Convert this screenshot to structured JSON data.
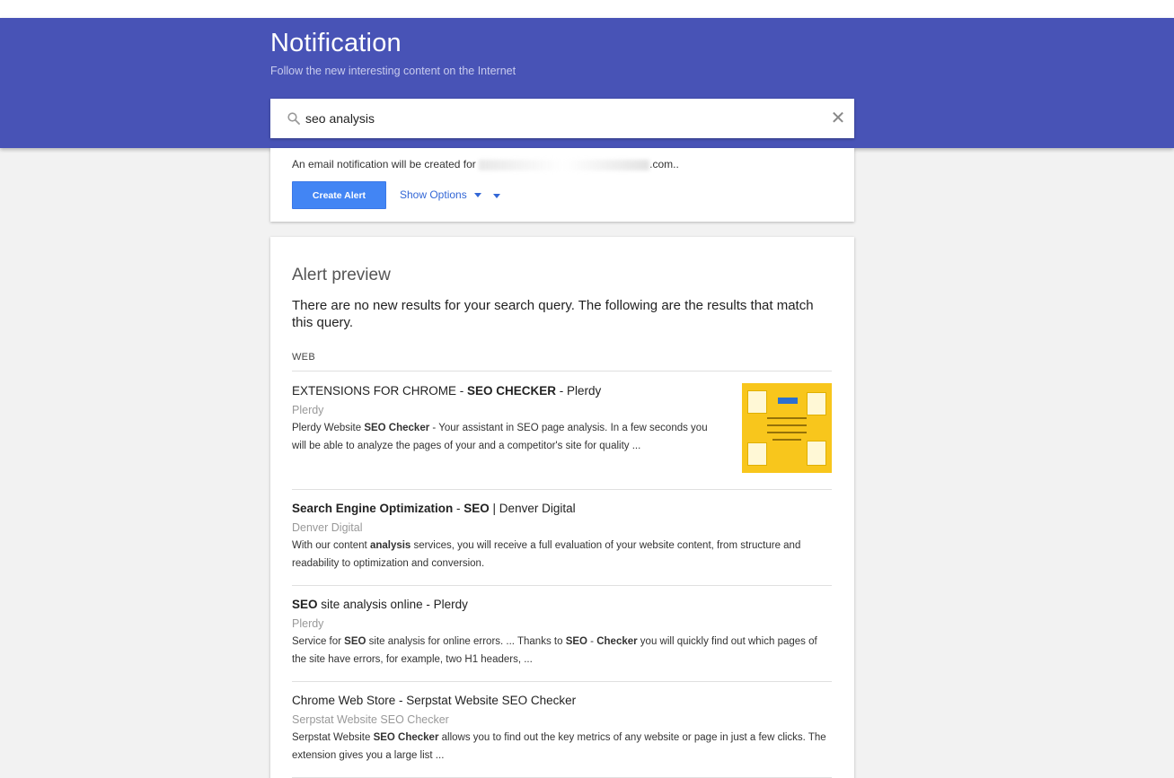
{
  "header": {
    "title": "Notification",
    "subtitle": "Follow the new interesting content on the Internet"
  },
  "search": {
    "value": "seo analysis",
    "search_icon": "search-icon",
    "clear_icon": "close-icon",
    "clear_glyph": "✕"
  },
  "alert_form": {
    "email_note_prefix": "An email notification will be created for",
    "email_note_suffix": ".com..",
    "create_button": "Create Alert",
    "show_options": "Show Options"
  },
  "preview": {
    "title": "Alert preview",
    "message": "There are no new results for your search query. The following are the results that match this query.",
    "section": "WEB",
    "results": [
      {
        "title_parts": [
          "EXTENSIONS FOR CHROME - ",
          "SEO CHECKER",
          " - Plerdy"
        ],
        "source": "Plerdy",
        "snippet_parts": [
          "Plerdy Website ",
          "SEO Checker",
          " - Your assistant in SEO page analysis. In a few seconds you will be able to analyze the pages of your and a competitor's site for quality ..."
        ],
        "has_thumbnail": true
      },
      {
        "title_parts": [
          "Search Engine Optimization",
          " - ",
          "SEO",
          " | Denver Digital"
        ],
        "source": "Denver Digital",
        "snippet_parts": [
          "With our content ",
          "analysis",
          " services, you will receive a full evaluation of your website content, from structure and readability to optimization and conversion."
        ]
      },
      {
        "title_parts": [
          "SEO",
          " site analysis online - Plerdy"
        ],
        "source": "Plerdy",
        "snippet_parts": [
          "Service for ",
          "SEO",
          " site analysis for online errors. ... Thanks to ",
          "SEO",
          " - ",
          "Checker",
          " you will quickly find out which pages of the site have errors, for example, two H1 headers, ..."
        ]
      },
      {
        "title_parts": [
          "Chrome Web Store - Serpstat Website SEO Checker"
        ],
        "source": "Serpstat Website SEO Checker",
        "snippet_parts": [
          "Serpstat Website ",
          "SEO Checker",
          " allows you to find out the key metrics of any website or page in just a few clicks. The extension gives you a large list ..."
        ]
      }
    ]
  },
  "colors": {
    "header_bg": "#4853b6",
    "button_bg": "#4285f4",
    "link": "#3367d6"
  }
}
